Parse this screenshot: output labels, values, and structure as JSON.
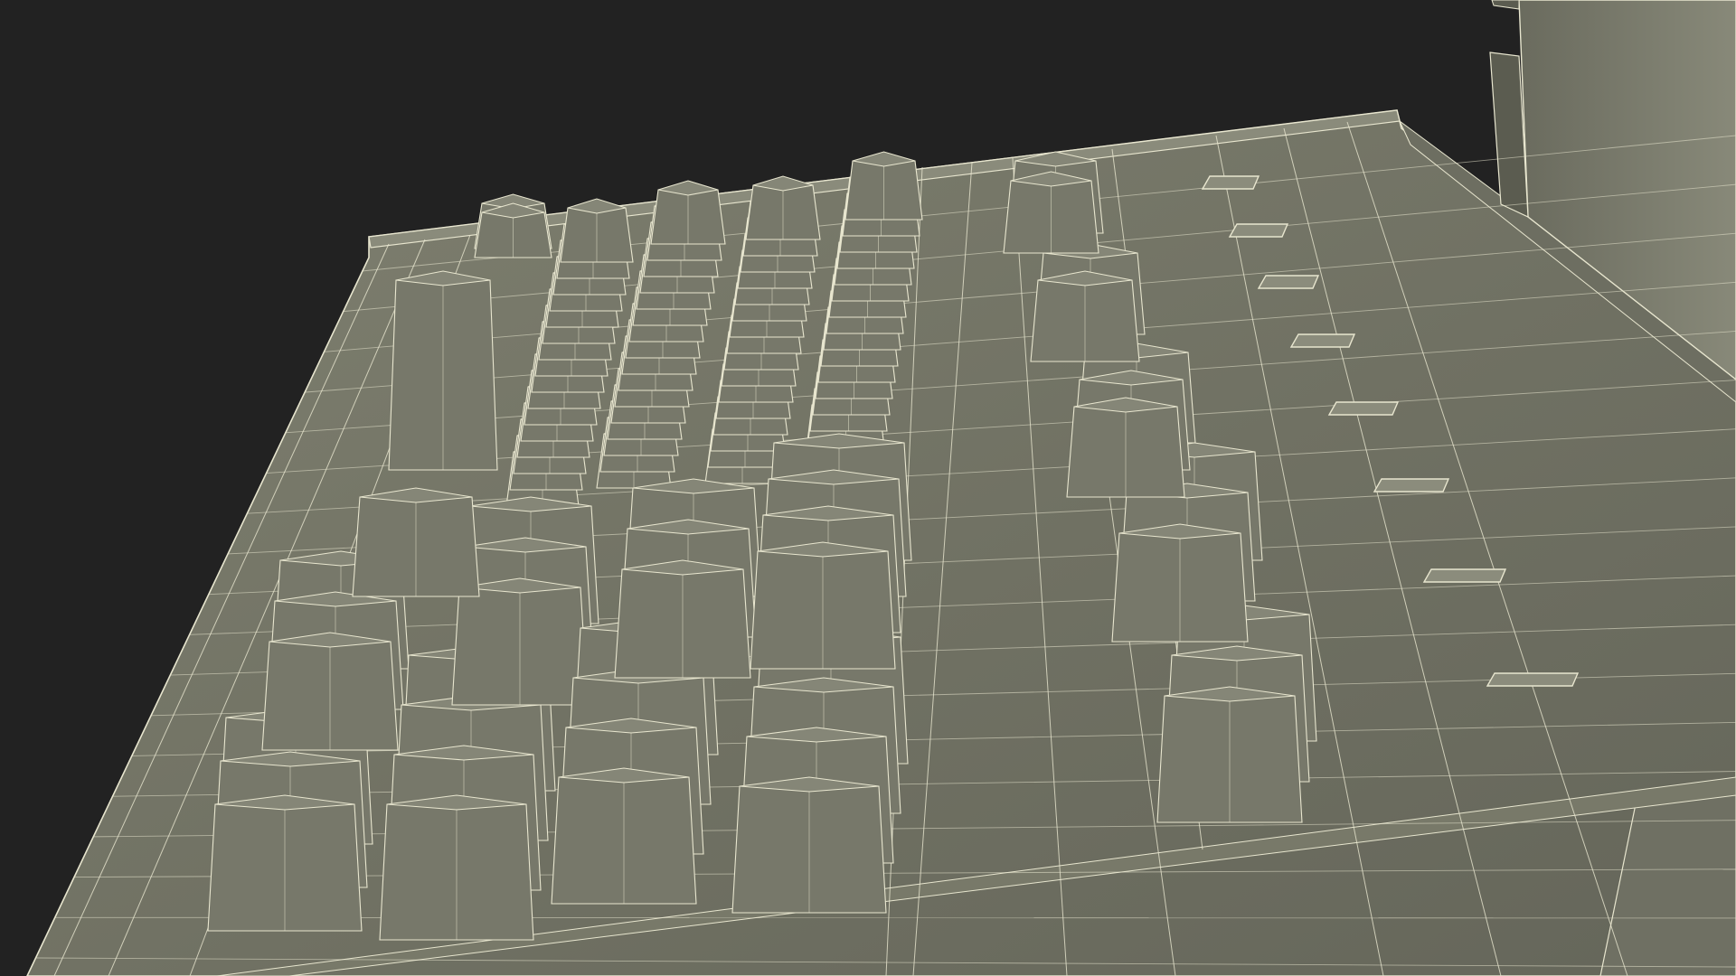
{
  "render": {
    "subject": "keyboard-wireframe-render",
    "colors": {
      "background": "#222222",
      "surface": "#7a7b6c",
      "surface_dark": "#5f6054",
      "surface_light": "#8b8c7c",
      "keycap": "#77786a",
      "keycap_top": "#858677",
      "wire": "#e8e6cf"
    }
  }
}
